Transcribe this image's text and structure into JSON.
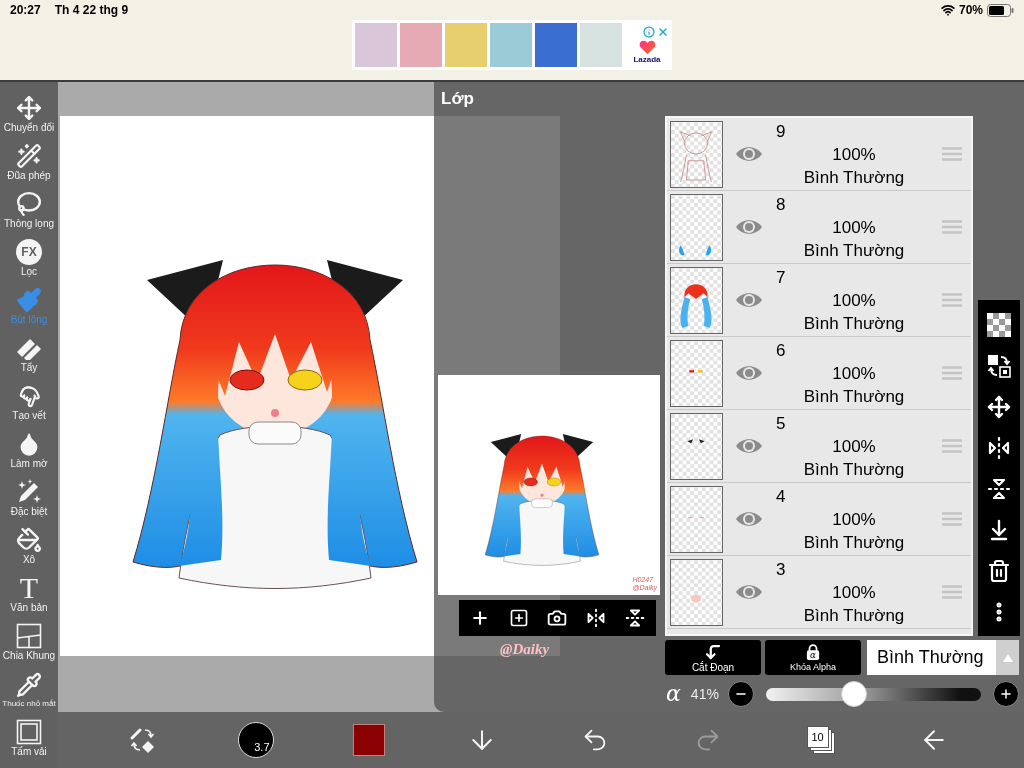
{
  "status_bar": {
    "time": "20:27",
    "date": "Th 4 22 thg 9",
    "battery": "70%"
  },
  "ad_banner": {
    "brand": "Lazada"
  },
  "tools": [
    {
      "kind": "move",
      "label": "Chuyển đổi",
      "selected": false
    },
    {
      "kind": "wand",
      "label": "Đũa phép",
      "selected": false
    },
    {
      "kind": "lasso",
      "label": "Thòng lọng",
      "selected": false
    },
    {
      "kind": "filter",
      "label": "Lọc",
      "icon_text": "FX",
      "selected": false
    },
    {
      "kind": "brush",
      "label": "Bút lông",
      "selected": true
    },
    {
      "kind": "eraser",
      "label": "Tẩy",
      "selected": false
    },
    {
      "kind": "smudge",
      "label": "Tạo vết",
      "selected": false
    },
    {
      "kind": "blur",
      "label": "Làm mờ",
      "selected": false
    },
    {
      "kind": "special",
      "label": "Đặc biệt",
      "selected": false
    },
    {
      "kind": "bucket",
      "label": "Xô",
      "selected": false
    },
    {
      "kind": "text",
      "label": "Văn bản",
      "icon_text": "T",
      "selected": false
    },
    {
      "kind": "frame",
      "label": "Chia Khung",
      "selected": false
    },
    {
      "kind": "eyedropper",
      "label": "Thuốc nhỏ mắt",
      "selected": false
    },
    {
      "kind": "canvas",
      "label": "Tấm vải",
      "selected": false
    }
  ],
  "canvas": {
    "signature": "@Daiky"
  },
  "layer_panel": {
    "title": "Lớp",
    "preview": {
      "signature": "H0247 @Daiky"
    },
    "preview_tools": [
      {
        "kind": "add"
      },
      {
        "kind": "add-layer"
      },
      {
        "kind": "camera"
      },
      {
        "kind": "flip-horizontal"
      },
      {
        "kind": "flip-vertical"
      }
    ],
    "layers": [
      {
        "number": "9",
        "visible": true,
        "opacity": "100%",
        "blend_mode": "Bình Thường"
      },
      {
        "number": "8",
        "visible": true,
        "opacity": "100%",
        "blend_mode": "Bình Thường"
      },
      {
        "number": "7",
        "visible": true,
        "opacity": "100%",
        "blend_mode": "Bình Thường"
      },
      {
        "number": "6",
        "visible": true,
        "opacity": "100%",
        "blend_mode": "Bình Thường"
      },
      {
        "number": "5",
        "visible": true,
        "opacity": "100%",
        "blend_mode": "Bình Thường"
      },
      {
        "number": "4",
        "visible": true,
        "opacity": "100%",
        "blend_mode": "Bình Thường"
      },
      {
        "number": "3",
        "visible": true,
        "opacity": "100%",
        "blend_mode": "Bình Thường"
      }
    ],
    "layer_tools": [
      {
        "kind": "transparency"
      },
      {
        "kind": "swap"
      },
      {
        "kind": "move"
      },
      {
        "kind": "flip-horizontal"
      },
      {
        "kind": "flip-vertical"
      },
      {
        "kind": "merge-down"
      },
      {
        "kind": "delete"
      },
      {
        "kind": "more"
      }
    ],
    "clip_button": {
      "label": "Cắt Đoạn"
    },
    "alpha_lock_button": {
      "label": "Khóa Alpha",
      "icon_text": "α"
    },
    "blend_mode_select": {
      "value": "Bình Thường"
    },
    "opacity": {
      "symbol": "α",
      "reading": "41%",
      "level": 0.41
    }
  },
  "bottom_toolbar": [
    {
      "kind": "tool-swap",
      "disabled": false
    },
    {
      "kind": "brush-size",
      "label": "3.7",
      "disabled": false
    },
    {
      "kind": "color",
      "color": "#8b0000",
      "disabled": false
    },
    {
      "kind": "download",
      "disabled": false
    },
    {
      "kind": "undo",
      "disabled": false
    },
    {
      "kind": "redo",
      "disabled": true
    },
    {
      "kind": "layers",
      "label": "10",
      "disabled": false
    },
    {
      "kind": "back",
      "disabled": false
    }
  ]
}
